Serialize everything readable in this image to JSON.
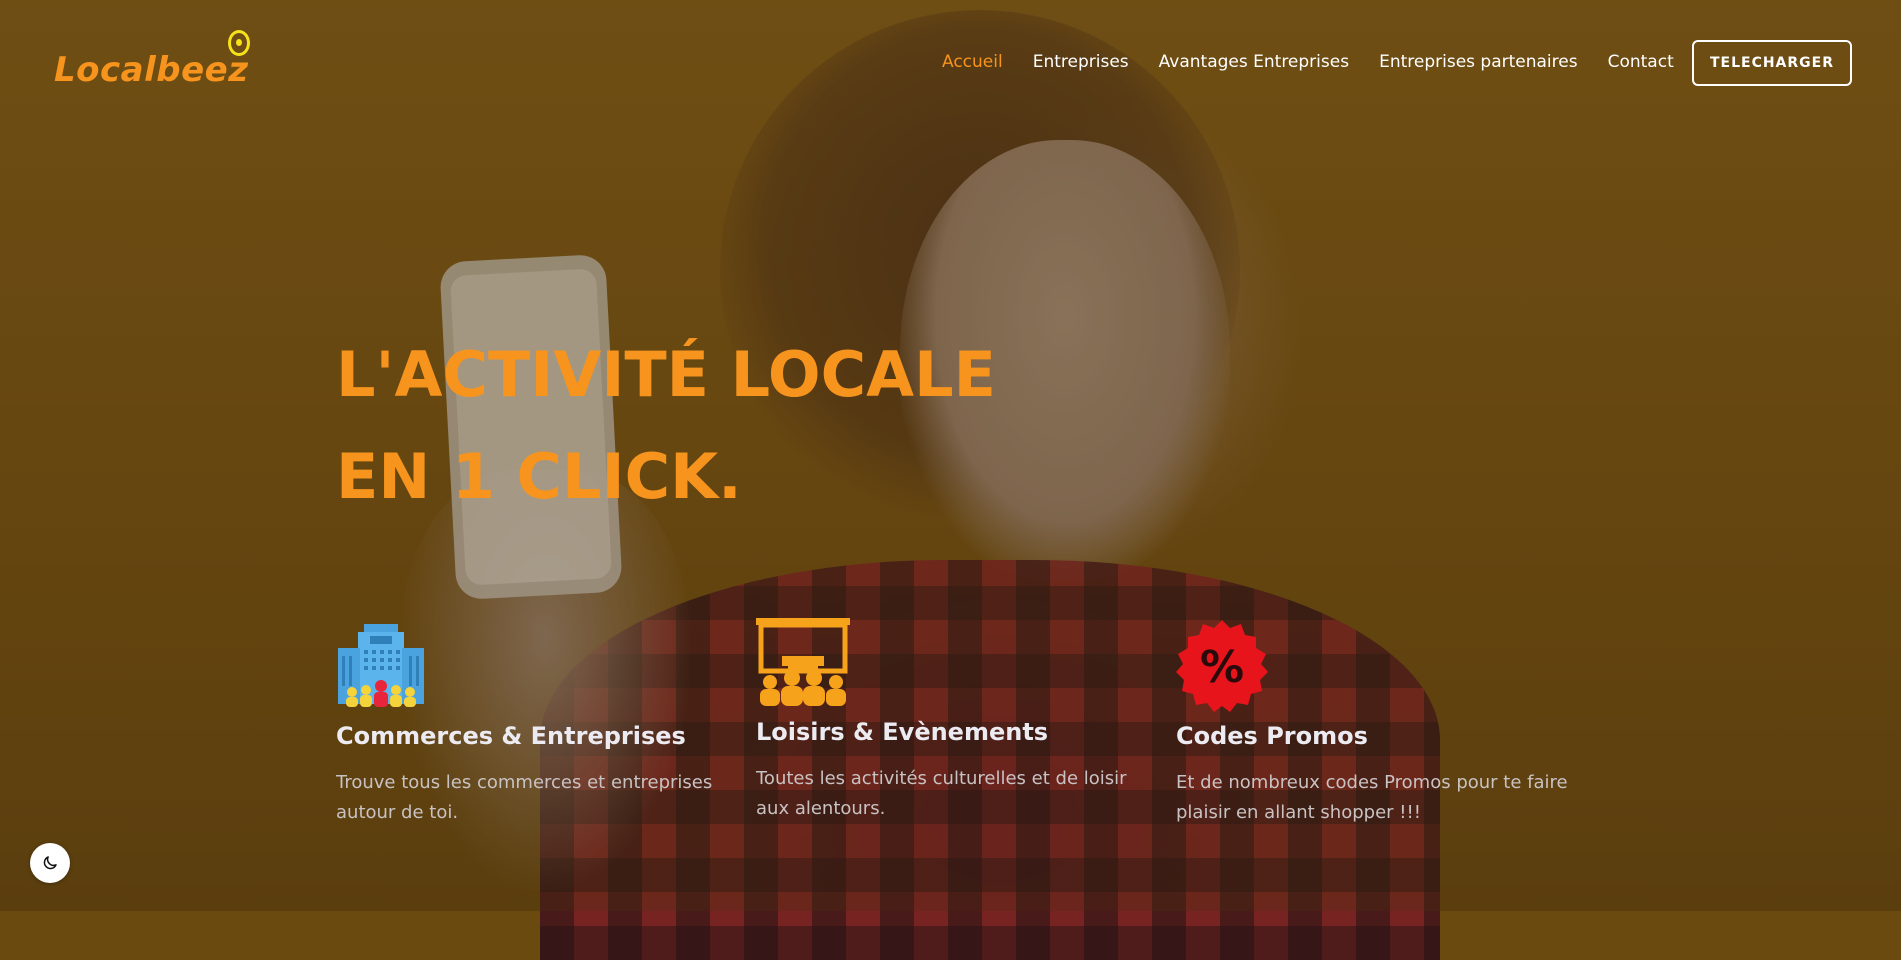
{
  "brand": {
    "logo_text": "Localbeez"
  },
  "nav": {
    "items": [
      {
        "label": "Accueil",
        "active": true
      },
      {
        "label": "Entreprises",
        "active": false
      },
      {
        "label": "Avantages Entreprises",
        "active": false
      },
      {
        "label": "Entreprises partenaires",
        "active": false
      },
      {
        "label": "Contact",
        "active": false
      }
    ],
    "download_label": "TELECHARGER"
  },
  "hero": {
    "headline_line1": "L'ACTIVITÉ LOCALE",
    "headline_line2": "EN 1 CLICK."
  },
  "features": [
    {
      "icon": "building-people-icon",
      "title": "Commerces & Entreprises",
      "description_line1": "Trouve tous les commerces et entreprises",
      "description_line2": "autour de toi."
    },
    {
      "icon": "cinema-audience-icon",
      "title": "Loisirs & Evènements",
      "description_line1": "Toutes les activités culturelles et de loisir",
      "description_line2": "aux alentours."
    },
    {
      "icon": "percent-badge-icon",
      "title": "Codes Promos",
      "description_line1": "Et de nombreux codes Promos pour te faire",
      "description_line2": "plaisir en allant shopper !!!"
    }
  ],
  "theme_toggle": {
    "icon": "moon-icon"
  },
  "colors": {
    "accent": "#f7941d",
    "nav_text": "#ffffff",
    "feature_title": "#ecebf2",
    "feature_desc": "#c9c2c3",
    "promo_red": "#e8141b",
    "logo_icon": "#f5e21b"
  }
}
